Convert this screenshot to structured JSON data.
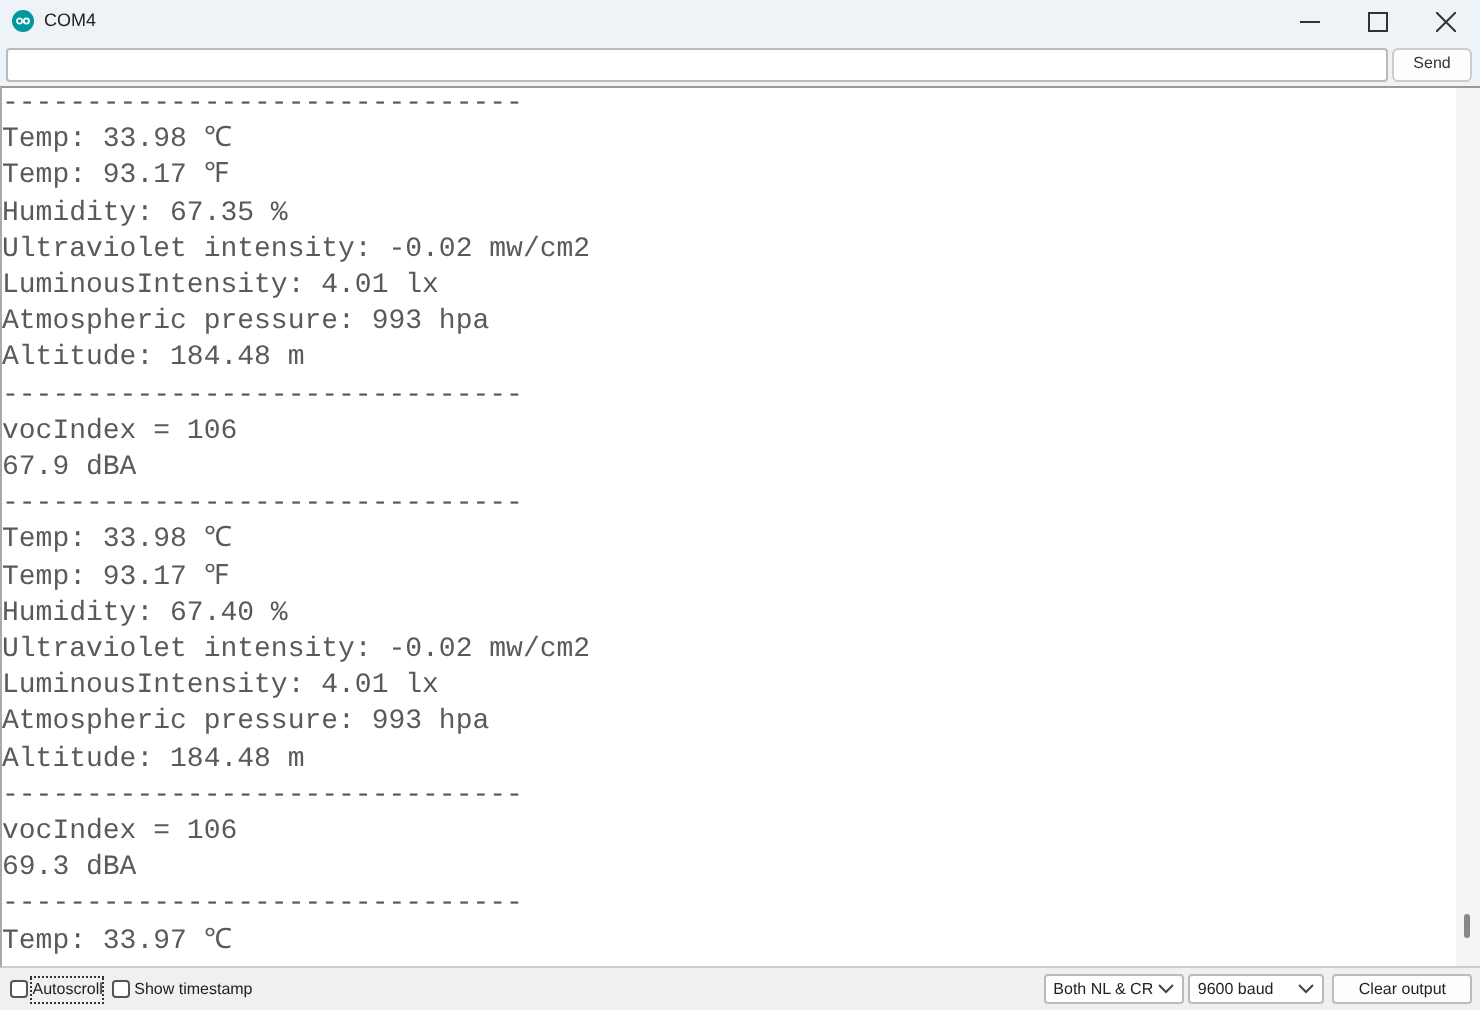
{
  "window": {
    "title": "COM4"
  },
  "send_button": {
    "label": "Send"
  },
  "output_lines": [
    "-------------------------------",
    "Temp: 33.98 ℃",
    "Temp: 93.17 ℉",
    "Humidity: 67.35 %",
    "Ultraviolet intensity: -0.02 mw/cm2",
    "LuminousIntensity: 4.01 lx",
    "Atmospheric pressure: 993 hpa",
    "Altitude: 184.48 m",
    "-------------------------------",
    "vocIndex = 106",
    "67.9 dBA",
    "-------------------------------",
    "Temp: 33.98 ℃",
    "Temp: 93.17 ℉",
    "Humidity: 67.40 %",
    "Ultraviolet intensity: -0.02 mw/cm2",
    "LuminousIntensity: 4.01 lx",
    "Atmospheric pressure: 993 hpa",
    "Altitude: 184.48 m",
    "-------------------------------",
    "vocIndex = 106",
    "69.3 dBA",
    "-------------------------------",
    "Temp: 33.97 ℃"
  ],
  "footer": {
    "checkboxes": [
      {
        "label": "Autoscroll",
        "checked": false,
        "focused": true
      },
      {
        "label": "Show timestamp",
        "checked": false,
        "focused": false
      }
    ],
    "line_ending": "Both NL & CR",
    "baud_rate": "9600 baud",
    "clear_button": {
      "label": "Clear output"
    }
  }
}
